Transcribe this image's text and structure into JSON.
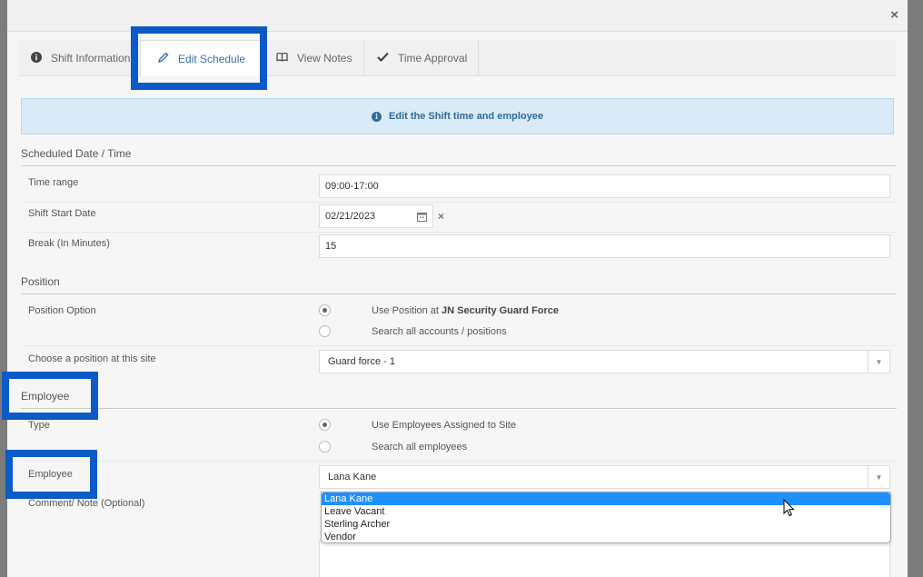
{
  "header": {
    "close_label": "×"
  },
  "tabs": [
    {
      "label": "Shift Information",
      "icon": "info-circle-icon"
    },
    {
      "label": "Edit Schedule",
      "icon": "pencil-icon"
    },
    {
      "label": "View Notes",
      "icon": "book-icon"
    },
    {
      "label": "Time Approval",
      "icon": "check-icon"
    }
  ],
  "banner": {
    "text": "Edit the Shift time and employee",
    "icon": "info-circle-icon"
  },
  "scheduled": {
    "section_title": "Scheduled Date / Time",
    "time_range_label": "Time range",
    "time_range_value": "09:00-17:00",
    "start_date_label": "Shift Start Date",
    "start_date_value": "02/21/2023",
    "break_label": "Break (In Minutes)",
    "break_value": "15"
  },
  "position": {
    "section_title": "Position",
    "option_label": "Position Option",
    "option_1_prefix": "Use Position at ",
    "option_1_site": "JN Security Guard Force",
    "option_2": "Search all accounts / positions",
    "choose_label": "Choose a position at this site",
    "choose_value": "Guard force - 1"
  },
  "employee": {
    "section_title": "Employee",
    "type_label": "Type",
    "type_option_1": "Use Employees Assigned to Site",
    "type_option_2": "Search all employees",
    "employee_label": "Employee",
    "employee_value": "Lana Kane",
    "comment_label": "Comment/ Note (Optional)",
    "options": [
      "Lana Kane",
      "Leave Vacant",
      "Sterling Archer",
      "Vendor"
    ]
  },
  "colors": {
    "highlight": "#0a5ac8",
    "accent": "#3a6ea5",
    "banner_bg": "#d9ebf7",
    "dropdown_selected": "#1e90ff"
  }
}
